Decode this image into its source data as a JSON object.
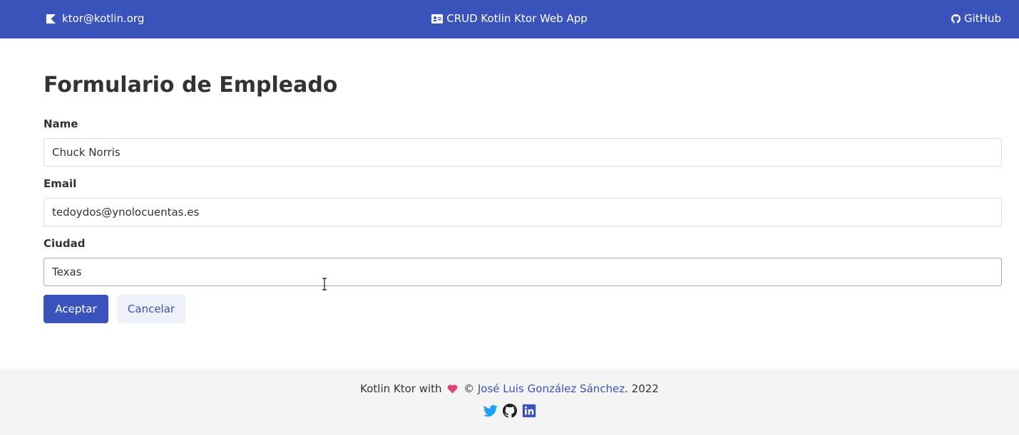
{
  "navbar": {
    "brand_label": "ktor@kotlin.org",
    "brand_icon": "kotlin-icon",
    "center_icon": "id-card-icon",
    "center_label": "CRUD Kotlin Ktor Web App",
    "github_icon": "github-icon",
    "github_label": "GitHub"
  },
  "form": {
    "title": "Formulario de Empleado",
    "fields": [
      {
        "label": "Name",
        "value": "Chuck Norris"
      },
      {
        "label": "Email",
        "value": "tedoydos@ynolocuentas.es"
      },
      {
        "label": "Ciudad",
        "value": "Texas"
      }
    ],
    "accept_label": "Aceptar",
    "cancel_label": "Cancelar"
  },
  "footer": {
    "prefix": "Kotlin Ktor with ",
    "heart_icon": "heart-icon",
    "copyright": " © ",
    "author": "José Luis González Sánchez",
    "suffix": ". 2022",
    "social_icons": [
      "twitter-icon",
      "github-icon",
      "linkedin-icon"
    ]
  },
  "colors": {
    "primary": "#3a52bb",
    "secondary_bg": "#eef0fa",
    "footer_bg": "#f4f4f4",
    "heart": "#e0436e",
    "twitter": "#1da1f2"
  }
}
